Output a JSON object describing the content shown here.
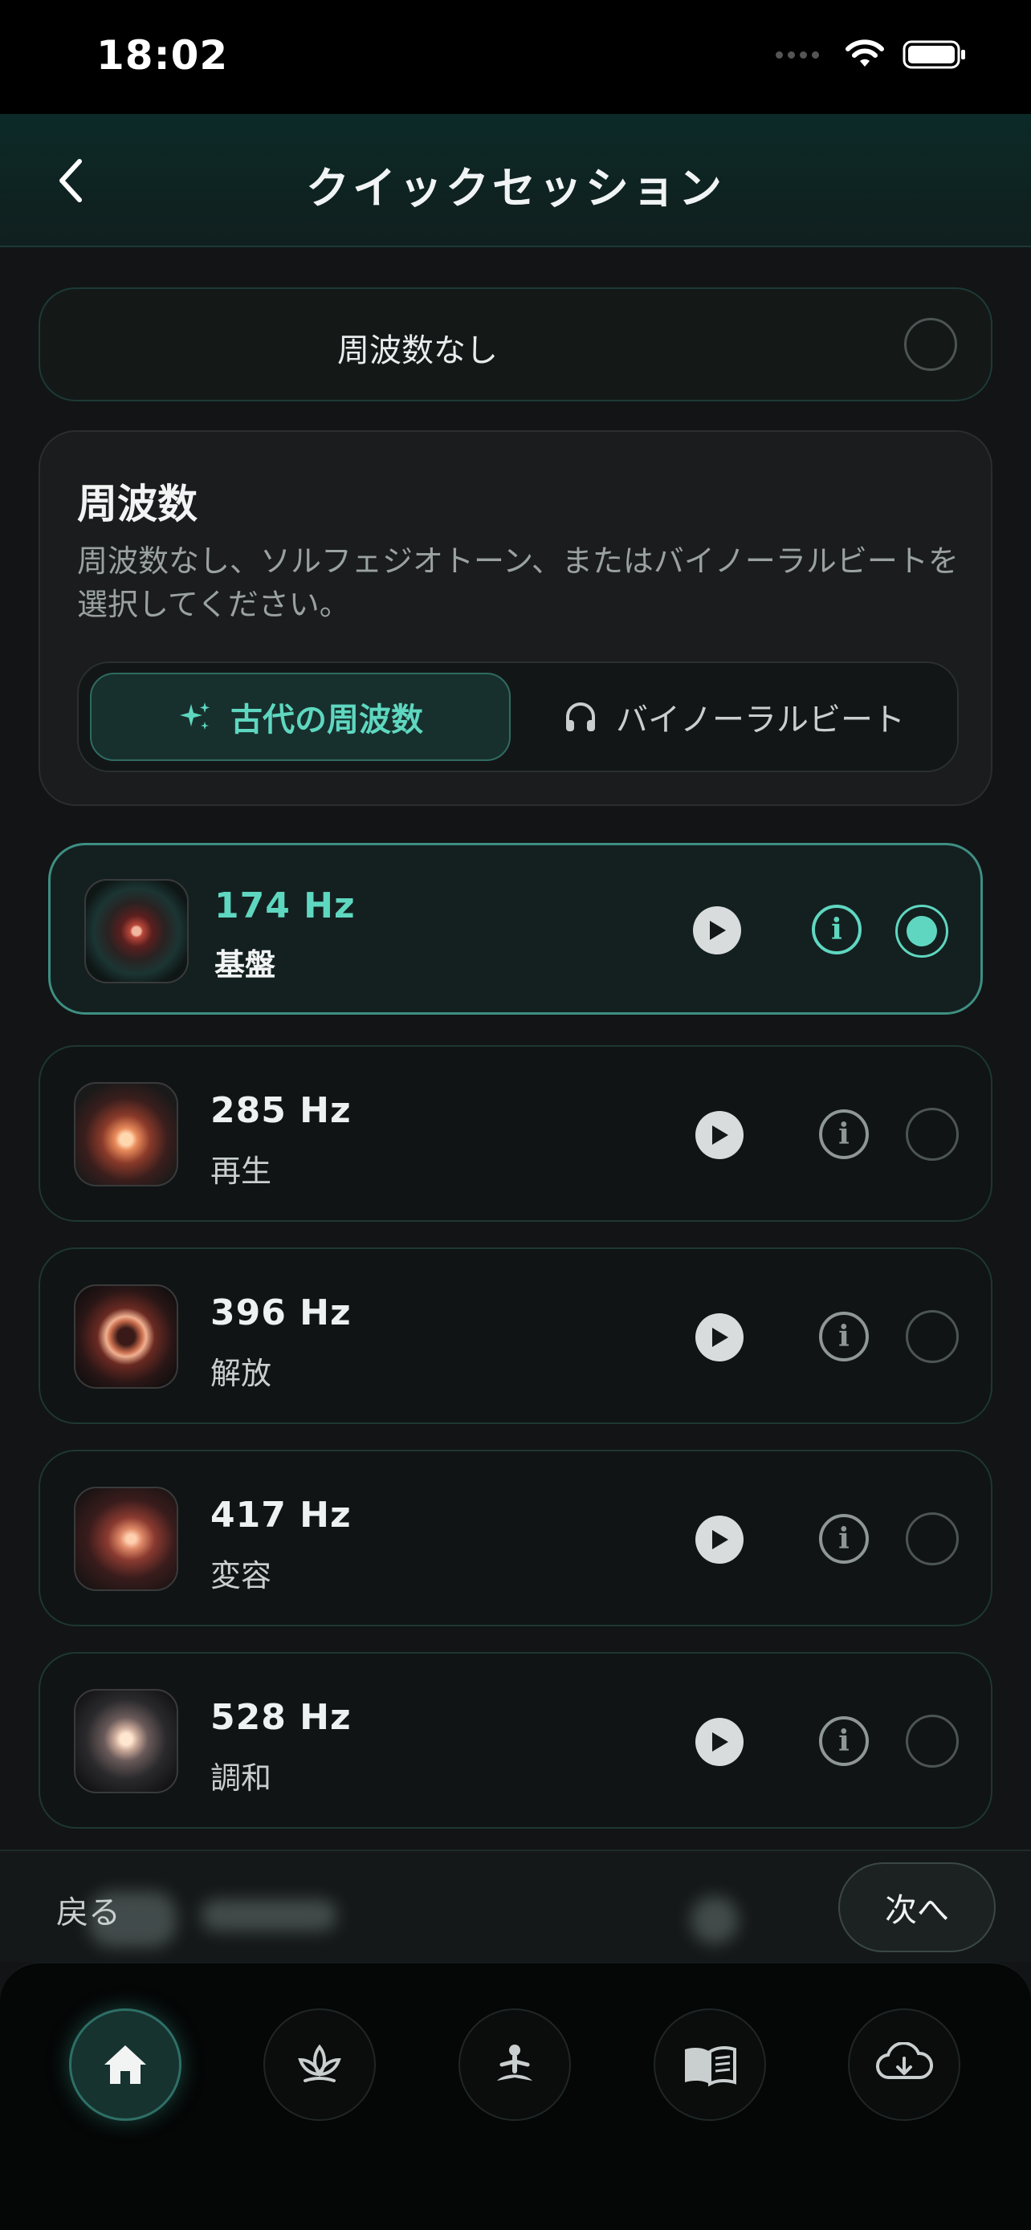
{
  "status_bar": {
    "time": "18:02"
  },
  "header": {
    "title": "クイックセッション"
  },
  "no_frequency": {
    "label": "周波数なし",
    "selected": false
  },
  "frequency_section": {
    "title": "周波数",
    "description": "周波数なし、ソルフェジオトーン、またはバイノーラルビートを選択してください。",
    "tabs": [
      {
        "label": "古代の周波数",
        "icon": "sparkles-icon",
        "active": true
      },
      {
        "label": "バイノーラルビート",
        "icon": "headphones-icon",
        "active": false
      }
    ]
  },
  "frequencies": [
    {
      "hz": "174 Hz",
      "name": "基盤",
      "selected": true
    },
    {
      "hz": "285 Hz",
      "name": "再生",
      "selected": false
    },
    {
      "hz": "396 Hz",
      "name": "解放",
      "selected": false
    },
    {
      "hz": "417 Hz",
      "name": "変容",
      "selected": false
    },
    {
      "hz": "528 Hz",
      "name": "調和",
      "selected": false
    }
  ],
  "bottom_actions": {
    "back_label": "戻る",
    "next_label": "次へ"
  },
  "tabbar": {
    "items": [
      {
        "icon": "home-icon",
        "active": true
      },
      {
        "icon": "lotus-icon",
        "active": false
      },
      {
        "icon": "meditation-icon",
        "active": false
      },
      {
        "icon": "book-icon",
        "active": false
      },
      {
        "icon": "cloud-download-icon",
        "active": false
      }
    ]
  },
  "colors": {
    "accent": "#5fd7c0",
    "background": "#121415"
  }
}
